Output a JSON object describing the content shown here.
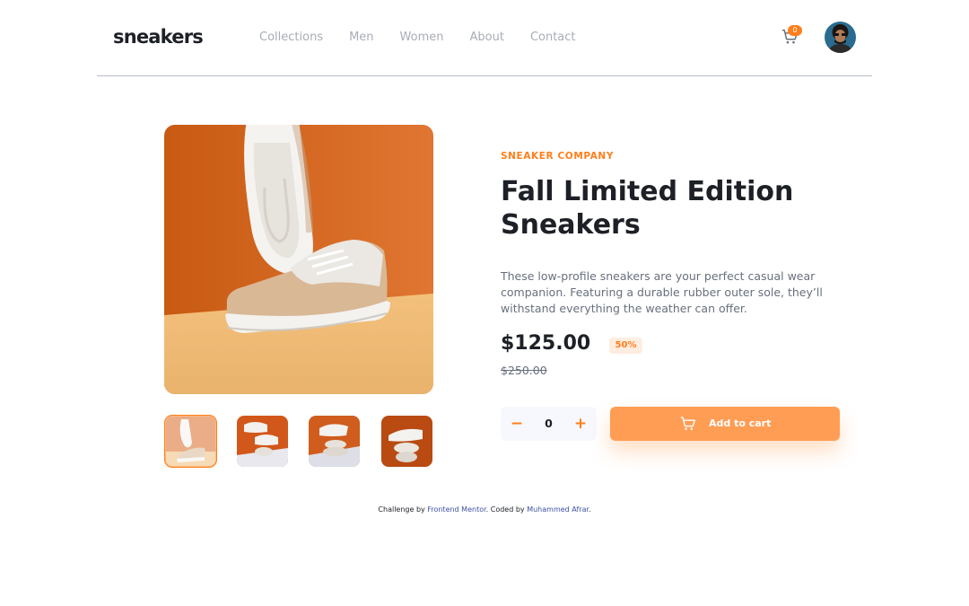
{
  "header": {
    "logo": "sneakers",
    "nav": [
      "Collections",
      "Men",
      "Women",
      "About",
      "Contact"
    ],
    "cart_count": "0",
    "cart_icon": "cart-icon",
    "avatar": "avatar"
  },
  "gallery": {
    "thumbnails": [
      "thumbnail-1",
      "thumbnail-2",
      "thumbnail-3",
      "thumbnail-4"
    ],
    "active_thumbnail": 1
  },
  "product": {
    "company": "SNEAKER COMPANY",
    "title": "Fall Limited Edition Sneakers",
    "description": "These low-profile sneakers are your perfect casual wear companion. Featuring a durable rubber outer sole, they’ll withstand everything the weather can offer.",
    "price": "$125.00",
    "discount": "50%",
    "old_price": "$250.00",
    "quantity": "0",
    "minus_symbol": "−",
    "plus_symbol": "+",
    "add_to_cart": "Add to cart"
  },
  "footer": {
    "prefix": "Challenge by ",
    "link1": "Frontend Mentor",
    "middle": ". Coded by ",
    "link2": "Muhammed Afrar",
    "suffix": "."
  },
  "colors": {
    "accent": "#ff7e1b",
    "accent_light": "#ffede0",
    "text_dark": "#1d2026",
    "text_muted": "#68707d",
    "link": "#3e52a3"
  }
}
